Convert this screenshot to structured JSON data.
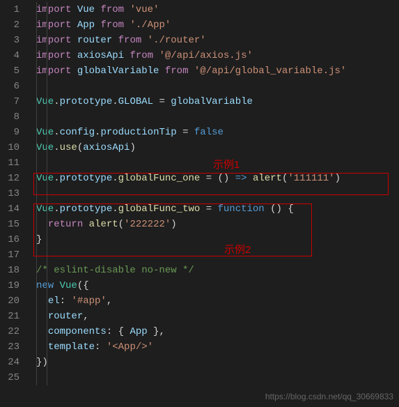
{
  "lineNumbers": [
    "1",
    "2",
    "3",
    "4",
    "5",
    "6",
    "7",
    "8",
    "9",
    "10",
    "11",
    "12",
    "13",
    "14",
    "15",
    "16",
    "17",
    "18",
    "19",
    "20",
    "21",
    "22",
    "23",
    "24",
    "25"
  ],
  "code": {
    "l1": {
      "kw1": "import",
      "var": "Vue",
      "kw2": "from",
      "str": "'vue'"
    },
    "l2": {
      "kw1": "import",
      "var": "App",
      "kw2": "from",
      "str": "'./App'"
    },
    "l3": {
      "kw1": "import",
      "var": "router",
      "kw2": "from",
      "str": "'./router'"
    },
    "l4": {
      "kw1": "import",
      "var": "axiosApi",
      "kw2": "from",
      "str": "'@/api/axios.js'"
    },
    "l5": {
      "kw1": "import",
      "var": "globalVariable",
      "kw2": "from",
      "str": "'@/api/global_variable.js'"
    },
    "l7": {
      "obj": "Vue",
      "p1": "prototype",
      "p2": "GLOBAL",
      "eq": "=",
      "val": "globalVariable"
    },
    "l9": {
      "obj": "Vue",
      "p1": "config",
      "p2": "productionTip",
      "eq": "=",
      "val": "false"
    },
    "l10": {
      "obj": "Vue",
      "fn": "use",
      "arg": "axiosApi"
    },
    "l12": {
      "obj": "Vue",
      "p1": "prototype",
      "p2": "globalFunc_one",
      "eq": "=",
      "fn": "alert",
      "arg": "'111111'"
    },
    "l14": {
      "obj": "Vue",
      "p1": "prototype",
      "p2": "globalFunc_two",
      "eq": "=",
      "kw": "function"
    },
    "l15": {
      "kw": "return",
      "fn": "alert",
      "arg": "'222222'"
    },
    "l18": {
      "cmt": "/* eslint-disable no-new */"
    },
    "l19": {
      "kw": "new",
      "cls": "Vue"
    },
    "l20": {
      "prop": "el",
      "str": "'#app'"
    },
    "l21": {
      "prop": "router"
    },
    "l22": {
      "prop": "components",
      "var": "App"
    },
    "l23": {
      "prop": "template",
      "str": "'<App/>'"
    }
  },
  "annotations": {
    "label1": "示例1",
    "label2": "示例2"
  },
  "watermark": "https://blog.csdn.net/qq_30669833"
}
